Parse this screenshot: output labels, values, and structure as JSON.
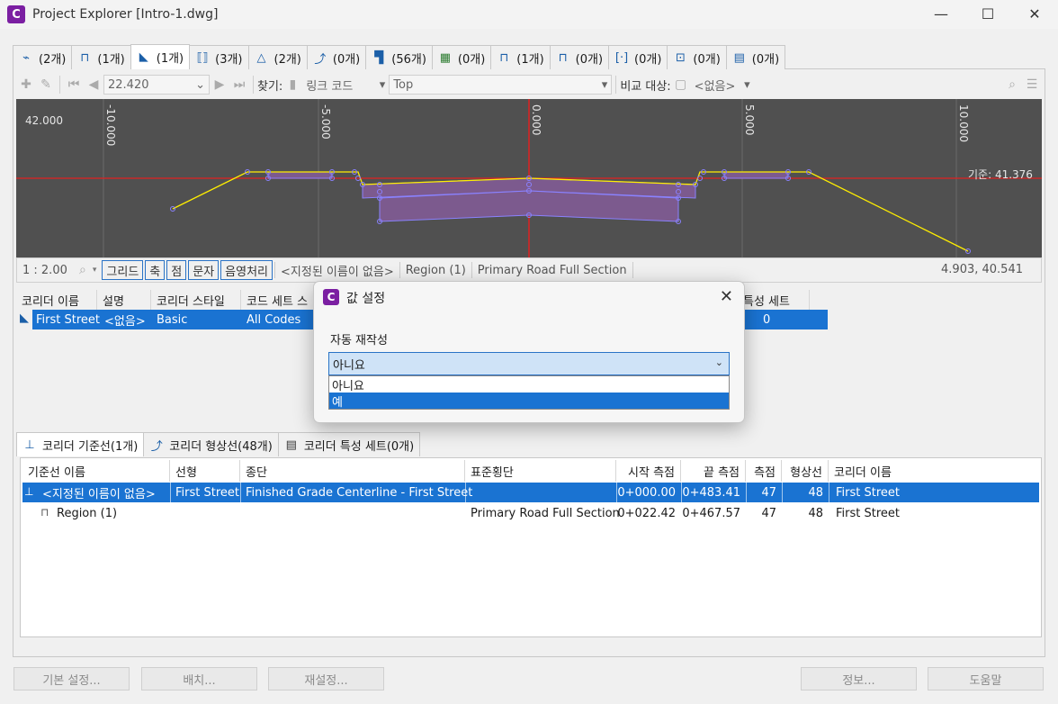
{
  "window": {
    "title": "Project Explorer [Intro-1.dwg]",
    "app_icon_letter": "C",
    "minimize": "—",
    "maximize": "☐",
    "close": "✕"
  },
  "top_tabs": [
    {
      "label": "(2개)",
      "icon": "alignment-icon"
    },
    {
      "label": "(1개)",
      "icon": "profile-icon"
    },
    {
      "label": "(1개)",
      "icon": "corridor-icon"
    },
    {
      "label": "(3개)",
      "icon": "assembly-icon"
    },
    {
      "label": "(2개)",
      "icon": "surface-icon"
    },
    {
      "label": "(0개)",
      "icon": "feature-line-icon"
    },
    {
      "label": "(56개)",
      "icon": "point-icon"
    },
    {
      "label": "(0개)",
      "icon": "parcel-icon"
    },
    {
      "label": "(1개)",
      "icon": "sample-line-icon"
    },
    {
      "label": "(0개)",
      "icon": "pipe-network-icon"
    },
    {
      "label": "(0개)",
      "icon": "view-frame-icon"
    },
    {
      "label": "(0개)",
      "icon": "intersection-icon"
    },
    {
      "label": "(0개)",
      "icon": "property-set-icon"
    }
  ],
  "toolbar": {
    "station_value": "22.420",
    "find_label": "찾기:",
    "find_mode": "링크 코드",
    "find_value": "Top",
    "compare_label": "비교 대상:",
    "compare_value": "<없음>"
  },
  "viewer": {
    "left_value": "42.000",
    "axis_labels": [
      "-10.000",
      "-5.000",
      "0.000",
      "5.000",
      "10.000"
    ],
    "datum_label": "기준: 41.376"
  },
  "status": {
    "scale": "1 : 2.00",
    "buttons": [
      "그리드",
      "축",
      "점",
      "문자",
      "음영처리"
    ],
    "unnamed": "<지정된 이름이 없음>",
    "region": "Region (1)",
    "assembly": "Primary Road Full Section",
    "coords": "4.903, 40.541"
  },
  "corridor_grid": {
    "headers": [
      "코리더 이름",
      "설명",
      "코리더 스타일",
      "코드 세트 스",
      "특성 세트"
    ],
    "row": {
      "name": "First Street",
      "description": "<없음>",
      "style": "Basic",
      "code_set": "All Codes",
      "property_sets": "0"
    }
  },
  "dialog": {
    "title": "값 설정",
    "label": "자동 재작성",
    "selected": "아니요",
    "options": [
      "아니요",
      "예"
    ],
    "highlighted_index": 1
  },
  "bottom_tabs": [
    {
      "label": "코리더 기준선(1개)",
      "icon": "baseline-icon"
    },
    {
      "label": "코리더 형상선(48개)",
      "icon": "feature-line-icon"
    },
    {
      "label": "코리더 특성 세트(0개)",
      "icon": "property-set-icon"
    }
  ],
  "baseline_grid": {
    "headers": [
      "기준선 이름",
      "선형",
      "종단",
      "표준횡단",
      "시작 측점",
      "끝 측점",
      "측점",
      "형상선",
      "코리더 이름"
    ],
    "rows": [
      {
        "name": "<지정된 이름이 없음>",
        "alignment": "First Street",
        "profile": "Finished Grade Centerline - First Street",
        "assembly": "",
        "start": "0+000.00",
        "end": "0+483.41",
        "stations": "47",
        "feature_lines": "48",
        "corridor": "First Street"
      },
      {
        "name": "Region (1)",
        "alignment": "",
        "profile": "",
        "assembly": "Primary Road Full Section",
        "start": "0+022.42",
        "end": "0+467.57",
        "stations": "47",
        "feature_lines": "48",
        "corridor": "First Street"
      }
    ]
  },
  "footer": {
    "defaults": "기본 설정...",
    "arrange": "배치...",
    "reset": "재설정...",
    "info": "정보...",
    "help": "도움말"
  }
}
